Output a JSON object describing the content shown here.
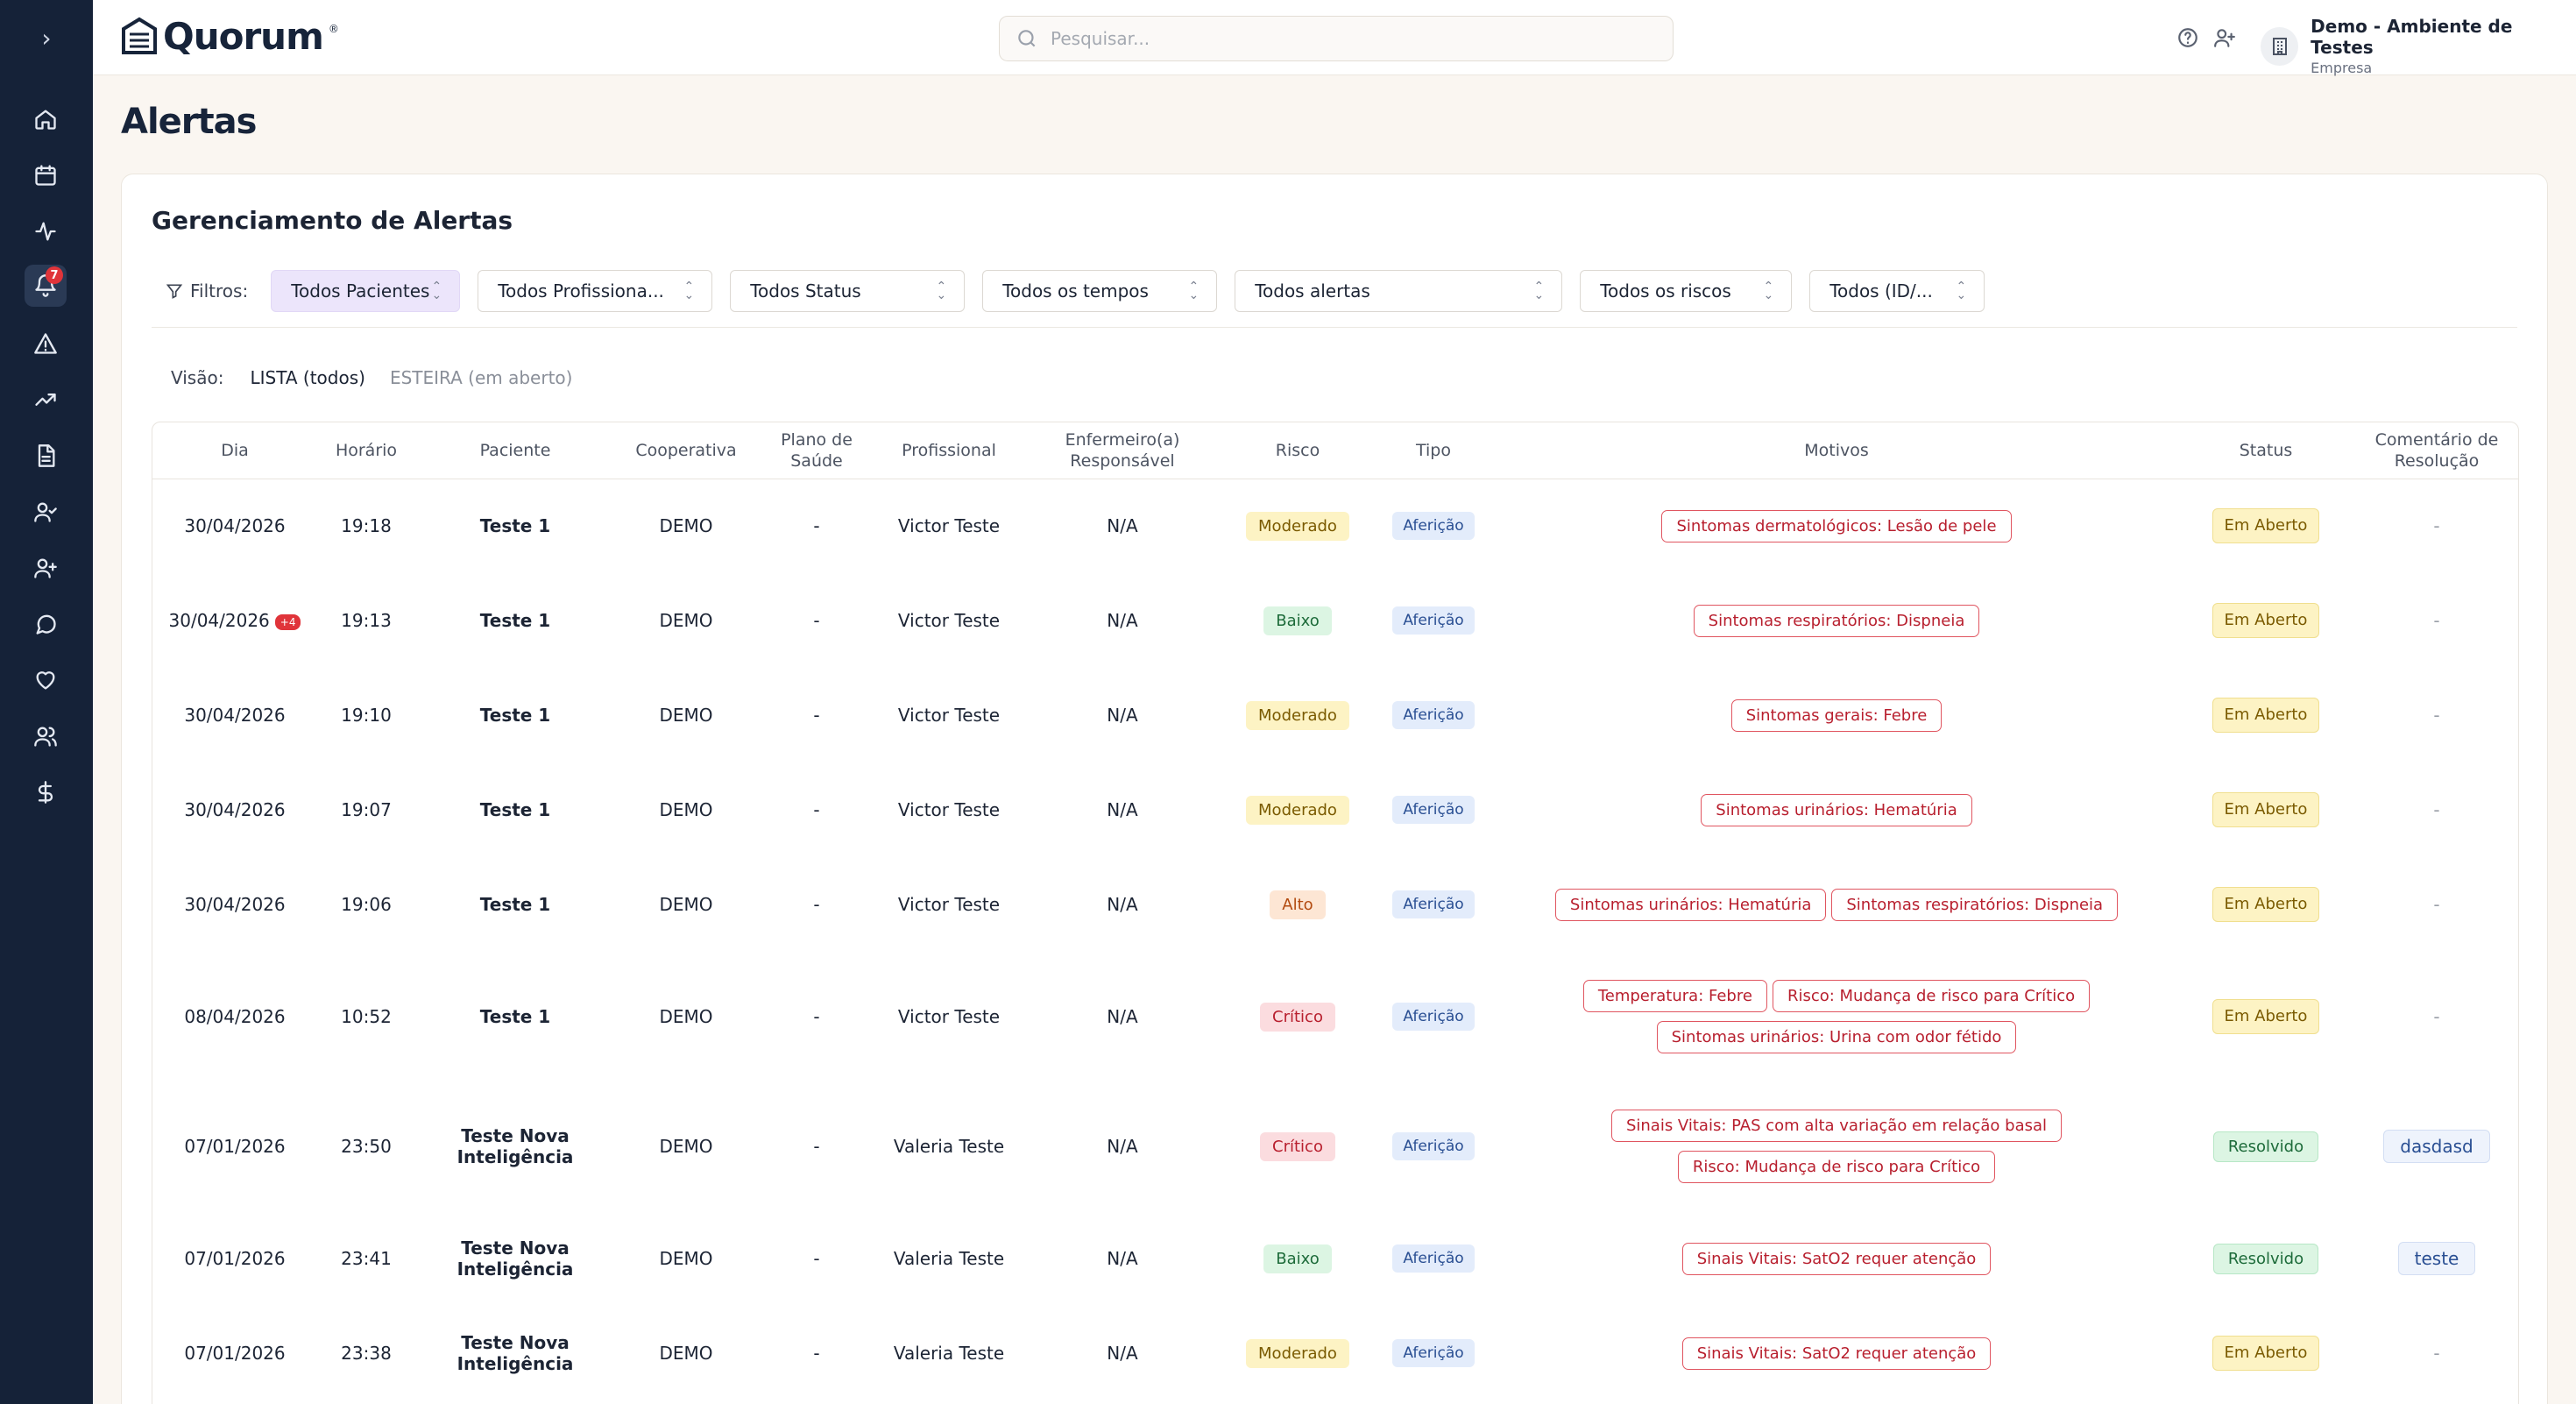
{
  "header": {
    "logo_text": "Quorum",
    "logo_reg": "®",
    "search_placeholder": "Pesquisar...",
    "org_name": "Demo - Ambiente de Testes",
    "org_role": "Empresa"
  },
  "sidebar": {
    "toggle": "›",
    "notif_count": "7"
  },
  "page": {
    "title": "Alertas",
    "card_title": "Gerenciamento de Alertas"
  },
  "filters": {
    "label": "Filtros:",
    "items": [
      "Todos Pacientes",
      "Todos Profissiona...",
      "Todos Status",
      "Todos os tempos",
      "Todos alertas",
      "Todos os riscos",
      "Todos (ID/..."
    ]
  },
  "visao": {
    "label": "Visão:",
    "tabs": [
      "LISTA (todos)",
      "ESTEIRA (em aberto)"
    ]
  },
  "table": {
    "headers": [
      "Dia",
      "Horário",
      "Paciente",
      "Cooperativa",
      "Plano de Saúde",
      "Profissional",
      "Enfermeiro(a) Responsável",
      "Risco",
      "Tipo",
      "Motivos",
      "Status",
      "Comentário de Resolução"
    ],
    "rows": [
      {
        "dia": "30/04/2026",
        "badge": "",
        "hora": "19:18",
        "paciente": "Teste 1",
        "coop": "DEMO",
        "plano": "-",
        "prof": "Victor Teste",
        "enf": "N/A",
        "risco": "Moderado",
        "risco_class": "moderado",
        "tipo": "Aferição",
        "motivos": [
          [
            "Sintomas dermatológicos: Lesão de pele"
          ]
        ],
        "status": "Em Aberto",
        "status_class": "aberto",
        "coment": "-"
      },
      {
        "dia": "30/04/2026",
        "badge": "+4",
        "hora": "19:13",
        "paciente": "Teste 1",
        "coop": "DEMO",
        "plano": "-",
        "prof": "Victor Teste",
        "enf": "N/A",
        "risco": "Baixo",
        "risco_class": "baixo",
        "tipo": "Aferição",
        "motivos": [
          [
            "Sintomas respiratórios: Dispneia"
          ]
        ],
        "status": "Em Aberto",
        "status_class": "aberto",
        "coment": "-"
      },
      {
        "dia": "30/04/2026",
        "badge": "",
        "hora": "19:10",
        "paciente": "Teste 1",
        "coop": "DEMO",
        "plano": "-",
        "prof": "Victor Teste",
        "enf": "N/A",
        "risco": "Moderado",
        "risco_class": "moderado",
        "tipo": "Aferição",
        "motivos": [
          [
            "Sintomas gerais: Febre"
          ]
        ],
        "status": "Em Aberto",
        "status_class": "aberto",
        "coment": "-"
      },
      {
        "dia": "30/04/2026",
        "badge": "",
        "hora": "19:07",
        "paciente": "Teste 1",
        "coop": "DEMO",
        "plano": "-",
        "prof": "Victor Teste",
        "enf": "N/A",
        "risco": "Moderado",
        "risco_class": "moderado",
        "tipo": "Aferição",
        "motivos": [
          [
            "Sintomas urinários: Hematúria"
          ]
        ],
        "status": "Em Aberto",
        "status_class": "aberto",
        "coment": "-"
      },
      {
        "dia": "30/04/2026",
        "badge": "",
        "hora": "19:06",
        "paciente": "Teste 1",
        "coop": "DEMO",
        "plano": "-",
        "prof": "Victor Teste",
        "enf": "N/A",
        "risco": "Alto",
        "risco_class": "alto",
        "tipo": "Aferição",
        "motivos": [
          [
            "Sintomas urinários: Hematúria",
            "Sintomas respiratórios: Dispneia"
          ]
        ],
        "status": "Em Aberto",
        "status_class": "aberto",
        "coment": "-"
      },
      {
        "dia": "08/04/2026",
        "badge": "",
        "hora": "10:52",
        "paciente": "Teste 1",
        "coop": "DEMO",
        "plano": "-",
        "prof": "Victor Teste",
        "enf": "N/A",
        "risco": "Crítico",
        "risco_class": "critico",
        "tipo": "Aferição",
        "motivos": [
          [
            "Temperatura: Febre",
            "Risco: Mudança de risco para Crítico"
          ],
          [
            "Sintomas urinários: Urina com odor fétido"
          ]
        ],
        "status": "Em Aberto",
        "status_class": "aberto",
        "coment": "-"
      },
      {
        "dia": "07/01/2026",
        "badge": "",
        "hora": "23:50",
        "paciente": "Teste Nova Inteligência",
        "coop": "DEMO",
        "plano": "-",
        "prof": "Valeria Teste",
        "enf": "N/A",
        "risco": "Crítico",
        "risco_class": "critico",
        "tipo": "Aferição",
        "motivos": [
          [
            "Sinais Vitais: PAS com alta variação em relação basal"
          ],
          [
            "Risco: Mudança de risco para Crítico"
          ]
        ],
        "status": "Resolvido",
        "status_class": "resolvido",
        "coment": "dasdasd"
      },
      {
        "dia": "07/01/2026",
        "badge": "",
        "hora": "23:41",
        "paciente": "Teste Nova Inteligência",
        "coop": "DEMO",
        "plano": "-",
        "prof": "Valeria Teste",
        "enf": "N/A",
        "risco": "Baixo",
        "risco_class": "baixo",
        "tipo": "Aferição",
        "motivos": [
          [
            "Sinais Vitais: SatO2 requer atenção"
          ]
        ],
        "status": "Resolvido",
        "status_class": "resolvido",
        "coment": "teste"
      },
      {
        "dia": "07/01/2026",
        "badge": "",
        "hora": "23:38",
        "paciente": "Teste Nova Inteligência",
        "coop": "DEMO",
        "plano": "-",
        "prof": "Valeria Teste",
        "enf": "N/A",
        "risco": "Moderado",
        "risco_class": "moderado",
        "tipo": "Aferição",
        "motivos": [
          [
            "Sinais Vitais: SatO2 requer atenção"
          ]
        ],
        "status": "Em Aberto",
        "status_class": "aberto",
        "coment": "-"
      }
    ]
  },
  "colors": {
    "sidebar_bg": "#152238",
    "accent_purple": "#ece5fb",
    "danger": "#e0343a"
  }
}
